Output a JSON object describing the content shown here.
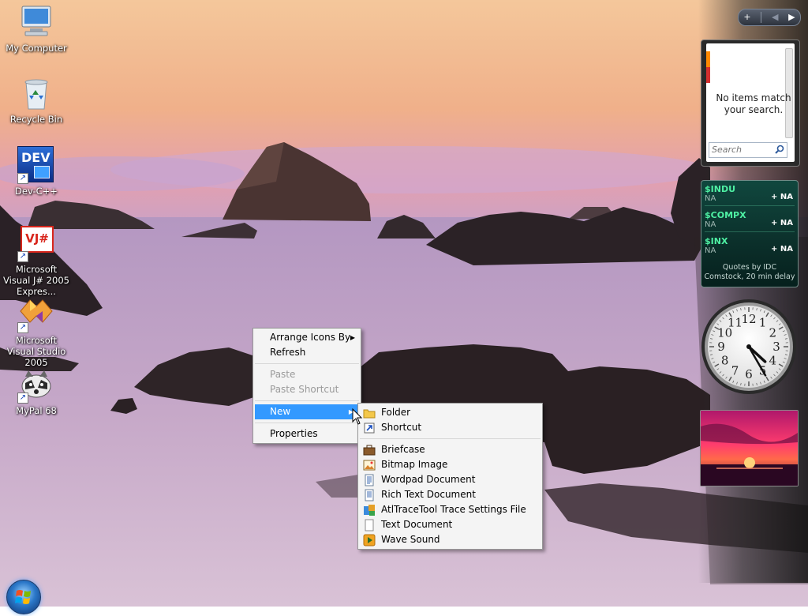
{
  "desktop": {
    "icons": [
      {
        "label": "My Computer",
        "icon": "my-computer-icon"
      },
      {
        "label": "Recycle Bin",
        "icon": "recycle-bin-icon"
      },
      {
        "label": "Dev-C++",
        "icon": "dev-cpp-icon",
        "glyph_text": "DEV"
      },
      {
        "label": "Microsoft Visual J# 2005 Expres...",
        "icon": "visual-jsharp-icon",
        "glyph_text": "VJ#"
      },
      {
        "label": "Microsoft Visual Studio 2005",
        "icon": "visual-studio-icon"
      },
      {
        "label": "MyPal 68",
        "icon": "mypal-icon"
      }
    ]
  },
  "context_menu": {
    "items": [
      {
        "label": "Arrange Icons By",
        "has_submenu": true,
        "enabled": true
      },
      {
        "label": "Refresh",
        "enabled": true
      },
      {
        "separator": true
      },
      {
        "label": "Paste",
        "enabled": false
      },
      {
        "label": "Paste Shortcut",
        "enabled": false
      },
      {
        "separator": true
      },
      {
        "label": "New",
        "has_submenu": true,
        "selected": true,
        "enabled": true
      },
      {
        "separator": true
      },
      {
        "label": "Properties",
        "enabled": true
      }
    ]
  },
  "new_submenu": {
    "items": [
      {
        "label": "Folder",
        "icon": "folder-icon"
      },
      {
        "label": "Shortcut",
        "icon": "shortcut-icon"
      },
      {
        "separator": true
      },
      {
        "label": "Briefcase",
        "icon": "briefcase-icon"
      },
      {
        "label": "Bitmap Image",
        "icon": "bitmap-image-icon"
      },
      {
        "label": "Wordpad Document",
        "icon": "wordpad-document-icon"
      },
      {
        "label": "Rich Text Document",
        "icon": "rich-text-document-icon"
      },
      {
        "label": "AtlTraceTool Trace Settings File",
        "icon": "atltrace-settings-icon"
      },
      {
        "label": "Text Document",
        "icon": "text-document-icon"
      },
      {
        "label": "Wave Sound",
        "icon": "wave-sound-icon"
      }
    ]
  },
  "sidebar": {
    "controls": {
      "add": "+",
      "prev": "◀",
      "next": "▶"
    },
    "contacts_gadget": {
      "message": "No items match your search.",
      "search_placeholder": "Search"
    },
    "stocks_gadget": {
      "quotes": [
        {
          "symbol": "$INDU",
          "value": "NA",
          "change": "+ NA"
        },
        {
          "symbol": "$COMPX",
          "value": "NA",
          "change": "+ NA"
        },
        {
          "symbol": "$INX",
          "value": "NA",
          "change": "+ NA"
        }
      ],
      "credit": "Quotes by IDC Comstock, 20 min delay"
    },
    "clock_gadget": {
      "numbers": [
        "12",
        "1",
        "2",
        "3",
        "4",
        "5",
        "6",
        "7",
        "8",
        "9",
        "10",
        "11"
      ],
      "time": {
        "hour": 4,
        "minute": 25
      }
    }
  },
  "colors": {
    "menu_highlight": "#3399ff",
    "stock_symbol": "#4ef0a3"
  }
}
